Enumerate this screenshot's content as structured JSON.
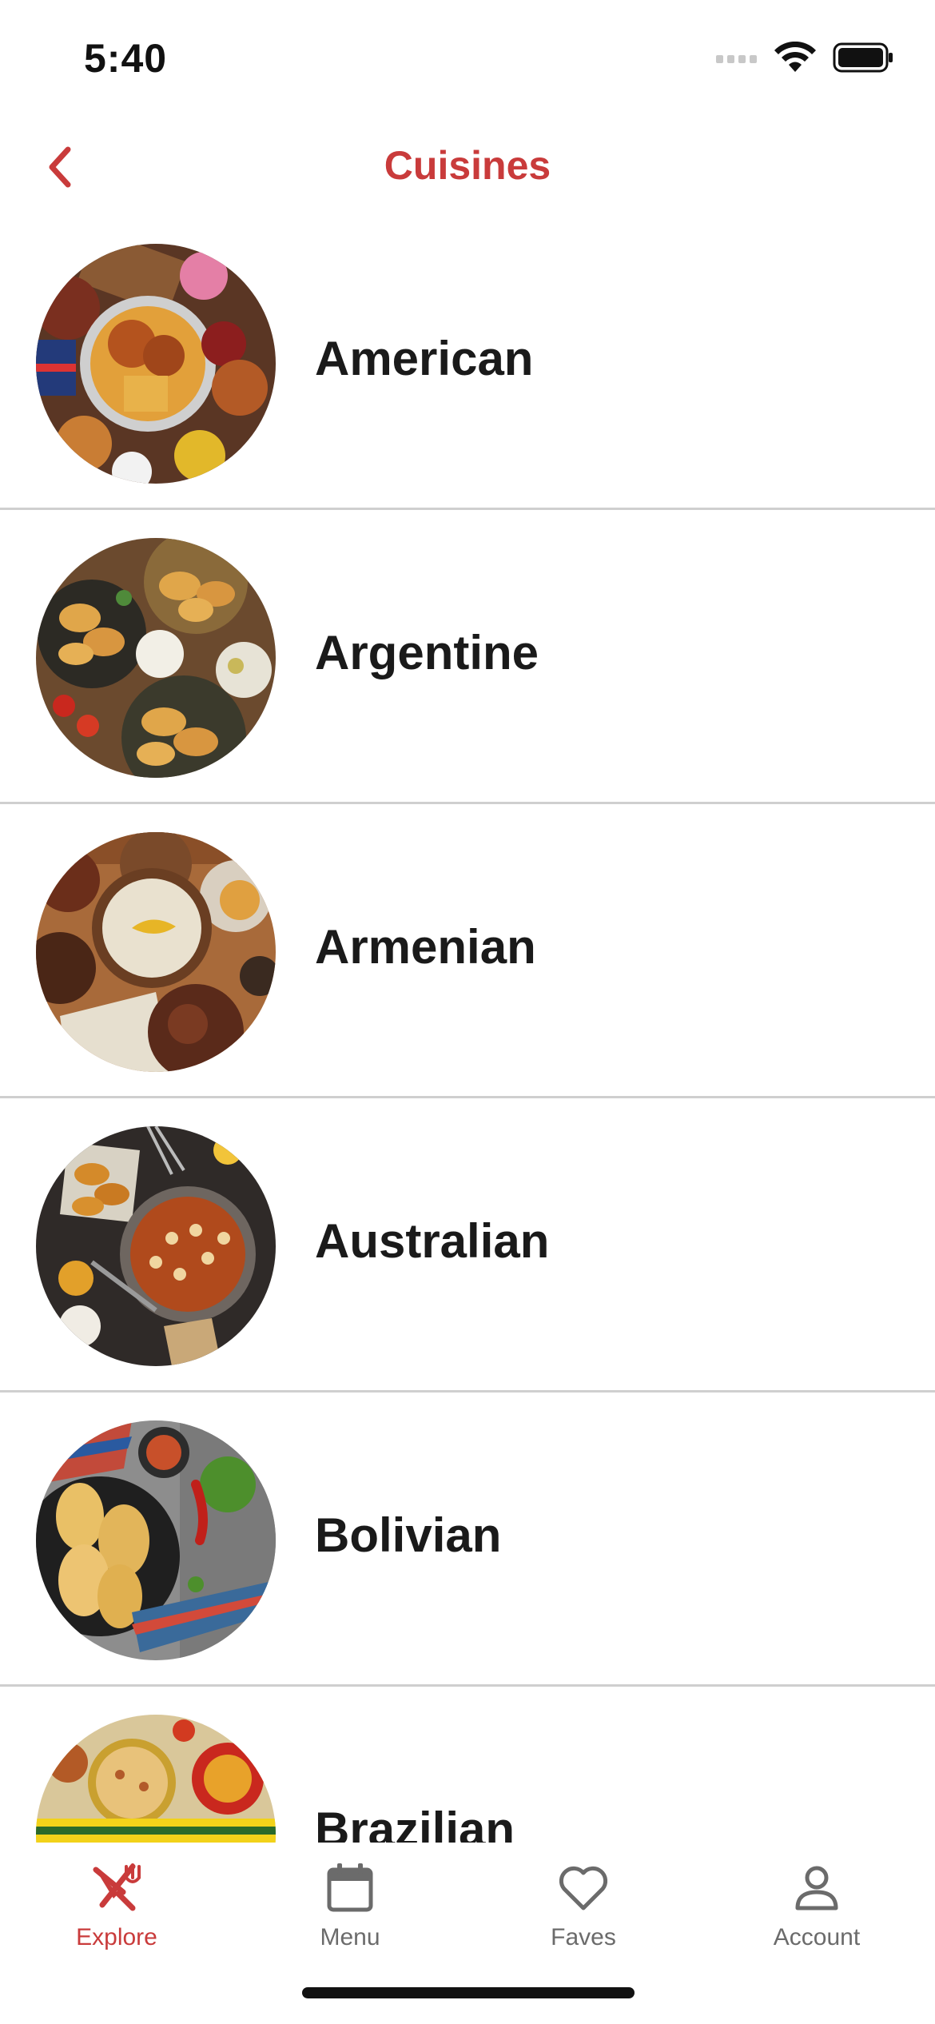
{
  "status_bar": {
    "time": "5:40"
  },
  "nav": {
    "title": "Cuisines"
  },
  "cuisines": [
    {
      "name": "American"
    },
    {
      "name": "Argentine"
    },
    {
      "name": "Armenian"
    },
    {
      "name": "Australian"
    },
    {
      "name": "Bolivian"
    },
    {
      "name": "Brazilian"
    }
  ],
  "tabs": [
    {
      "label": "Explore",
      "icon": "fork-knife-icon",
      "active": true
    },
    {
      "label": "Menu",
      "icon": "calendar-icon",
      "active": false
    },
    {
      "label": "Faves",
      "icon": "heart-icon",
      "active": false
    },
    {
      "label": "Account",
      "icon": "person-icon",
      "active": false
    }
  ],
  "colors": {
    "accent": "#c93b3b",
    "text": "#1a1a1a",
    "inactive_tab": "#6b6b6b",
    "divider": "#cfcfcf"
  }
}
